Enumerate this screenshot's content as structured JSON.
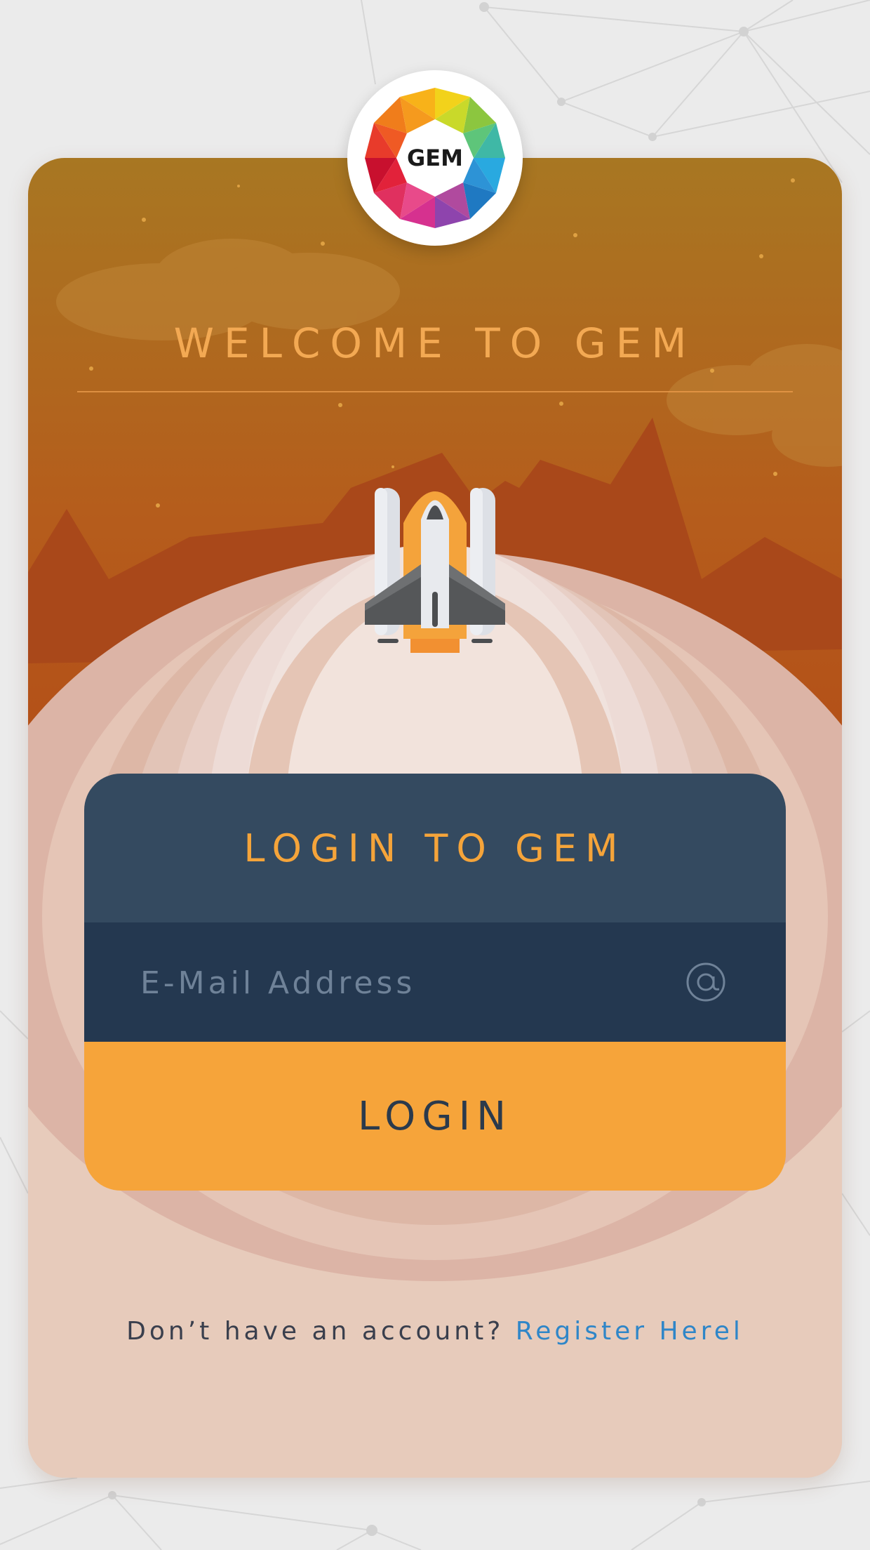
{
  "header": {
    "welcome_title": "WELCOME TO GEM",
    "logo_text": "GEM"
  },
  "login": {
    "title": "LOGIN TO GEM",
    "email_placeholder": "E-Mail Address",
    "email_value": "",
    "email_icon": "at-sign-icon",
    "button_label": "LOGIN"
  },
  "footer": {
    "prompt": "Don’t have an account?",
    "register_link": "Register Herel"
  },
  "colors": {
    "accent_orange": "#f6a43a",
    "panel_dark": "#344a60",
    "input_dark": "#243850",
    "link_blue": "#2f86c8",
    "page_bg": "#ebebeb"
  }
}
